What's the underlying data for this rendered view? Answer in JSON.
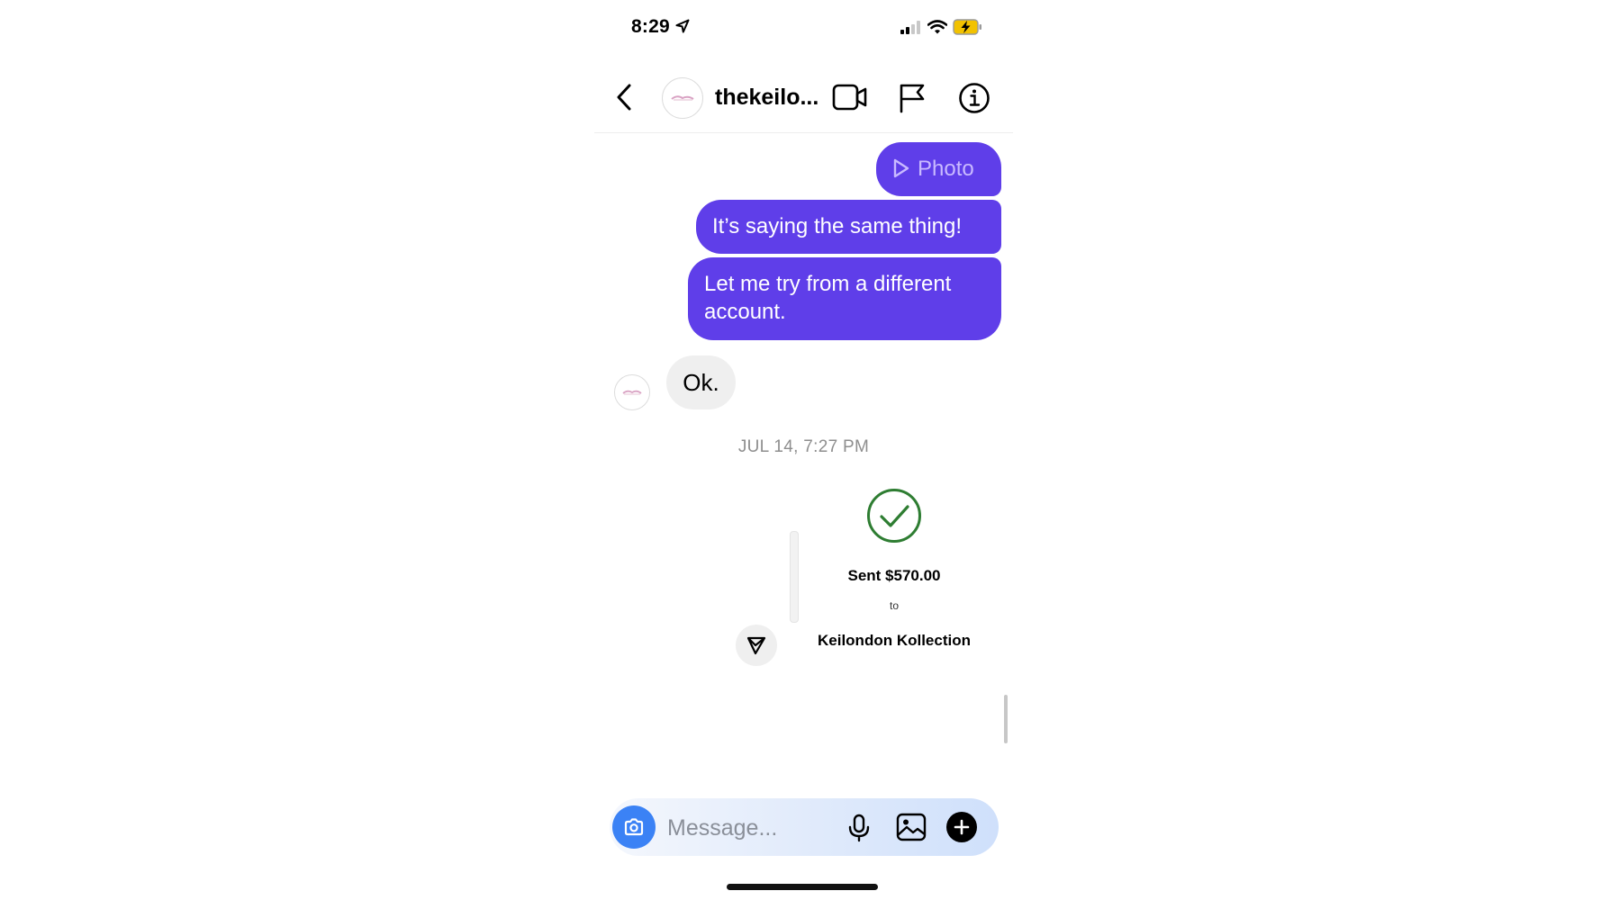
{
  "status_bar": {
    "time": "8:29"
  },
  "header": {
    "username": "thekeilo..."
  },
  "messages": {
    "photo_label": "Photo",
    "outgoing_1": "It’s saying the same thing!",
    "outgoing_2": "Let me try from a different account.",
    "incoming_1": "Ok."
  },
  "timestamp": "JUL 14, 7:27 PM",
  "payment": {
    "sent_label": "Sent $570.00",
    "to_label": "to",
    "recipient": "Keilondon Kollection"
  },
  "composer": {
    "placeholder": "Message..."
  },
  "colors": {
    "outgoing_bubble": "#5f3ee9",
    "incoming_bubble": "#efefef",
    "camera_button": "#3b82f5",
    "success_check": "#2e7d32"
  },
  "icons": {
    "status": [
      "location-arrow-icon",
      "cell-signal-icon",
      "wifi-icon",
      "battery-charging-icon"
    ],
    "header": [
      "back-chevron-icon",
      "video-call-icon",
      "flag-icon",
      "info-icon"
    ],
    "composer": [
      "camera-icon",
      "microphone-icon",
      "gallery-icon",
      "plus-icon"
    ],
    "payment": [
      "check-circle-icon",
      "send-icon"
    ]
  }
}
